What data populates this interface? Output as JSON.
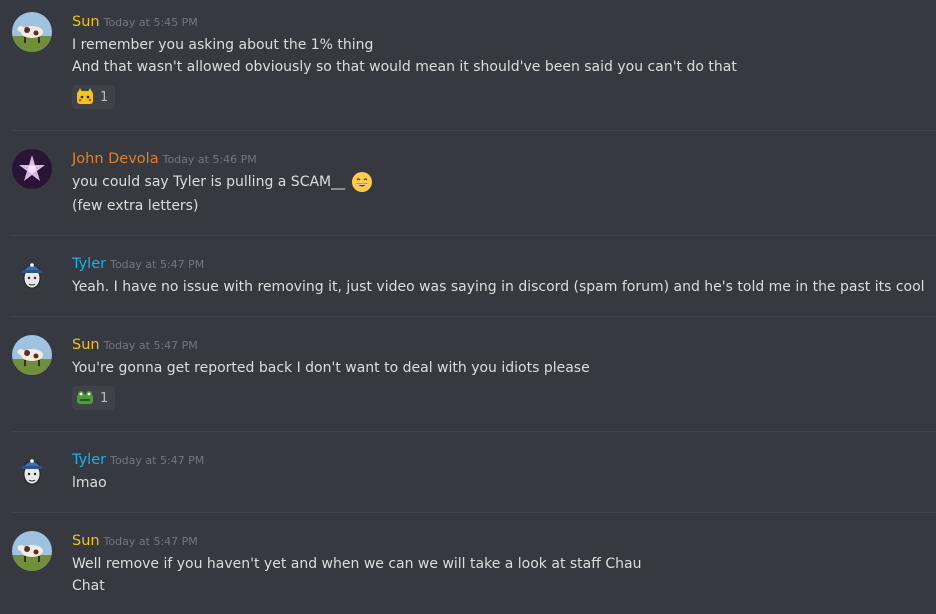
{
  "colors": {
    "background": "#36393f",
    "sun": "#f1c40f",
    "john": "#e67e22",
    "tyler": "#1ab1e8",
    "text": "#dcddde",
    "timestamp": "#72767d"
  },
  "messages": [
    {
      "author": "Sun",
      "time": "Today at 5:45 PM",
      "lines": [
        "I remember you asking about the 1% thing",
        "And that wasn't allowed obviously so that would mean it should've been said you can't do that"
      ],
      "reaction": {
        "emoji": "pikachu-emoji",
        "count": "1"
      }
    },
    {
      "author": "John Devola",
      "time": "Today at 5:46 PM",
      "lines": [
        "you could say Tyler is pulling a SCAM__",
        "(few extra letters)"
      ],
      "inline_emoji": "grin-emoji"
    },
    {
      "author": "Tyler",
      "time": "Today at 5:47 PM",
      "lines": [
        "Yeah. I have no issue with removing it, just video was saying in discord (spam forum) and he's told me in the past its cool"
      ]
    },
    {
      "author": "Sun",
      "time": "Today at 5:47 PM",
      "lines": [
        "You're gonna get reported back I don't want to deal with you idiots please"
      ],
      "reaction": {
        "emoji": "frog-emoji",
        "count": "1"
      }
    },
    {
      "author": "Tyler",
      "time": "Today at 5:47 PM",
      "lines": [
        "lmao"
      ]
    },
    {
      "author": "Sun",
      "time": "Today at 5:47 PM",
      "lines": [
        "Well remove if you haven't yet and when we can we will take a look at staff Chau",
        "Chat"
      ]
    }
  ]
}
